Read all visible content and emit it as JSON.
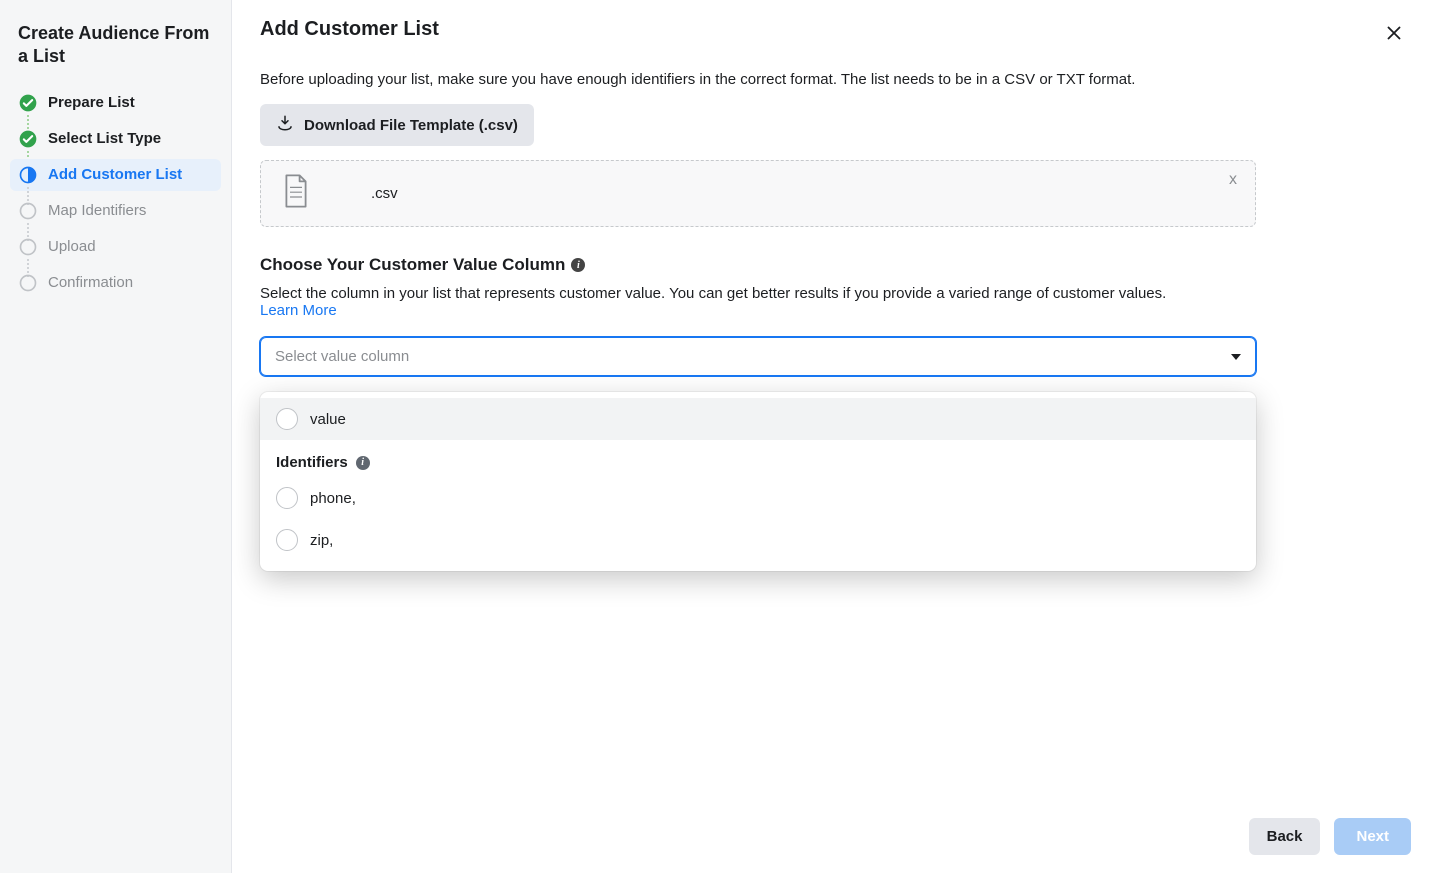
{
  "sidebar": {
    "title": "Create Audience From a List",
    "steps": [
      {
        "label": "Prepare List"
      },
      {
        "label": "Select List Type"
      },
      {
        "label": "Add Customer List"
      },
      {
        "label": "Map Identifiers"
      },
      {
        "label": "Upload"
      },
      {
        "label": "Confirmation"
      }
    ]
  },
  "header": {
    "title": "Add Customer List"
  },
  "intro": "Before uploading your list, make sure you have enough identifiers in the correct format. The list needs to be in a CSV or TXT format.",
  "toolbar": {
    "download_label": "Download File Template (.csv)"
  },
  "file": {
    "name": ".csv",
    "remove_label": "x"
  },
  "section": {
    "title": "Choose Your Customer Value Column",
    "desc": "Select the column in your list that represents customer value. You can get better results if you provide a varied range of customer values.",
    "learn_more": "Learn More"
  },
  "select": {
    "placeholder": "Select value column"
  },
  "dropdown": {
    "primary_option": "value",
    "identifiers_heading": "Identifiers",
    "options": [
      {
        "label": "phone,"
      },
      {
        "label": "zip,"
      }
    ]
  },
  "footer": {
    "back": "Back",
    "next": "Next"
  }
}
